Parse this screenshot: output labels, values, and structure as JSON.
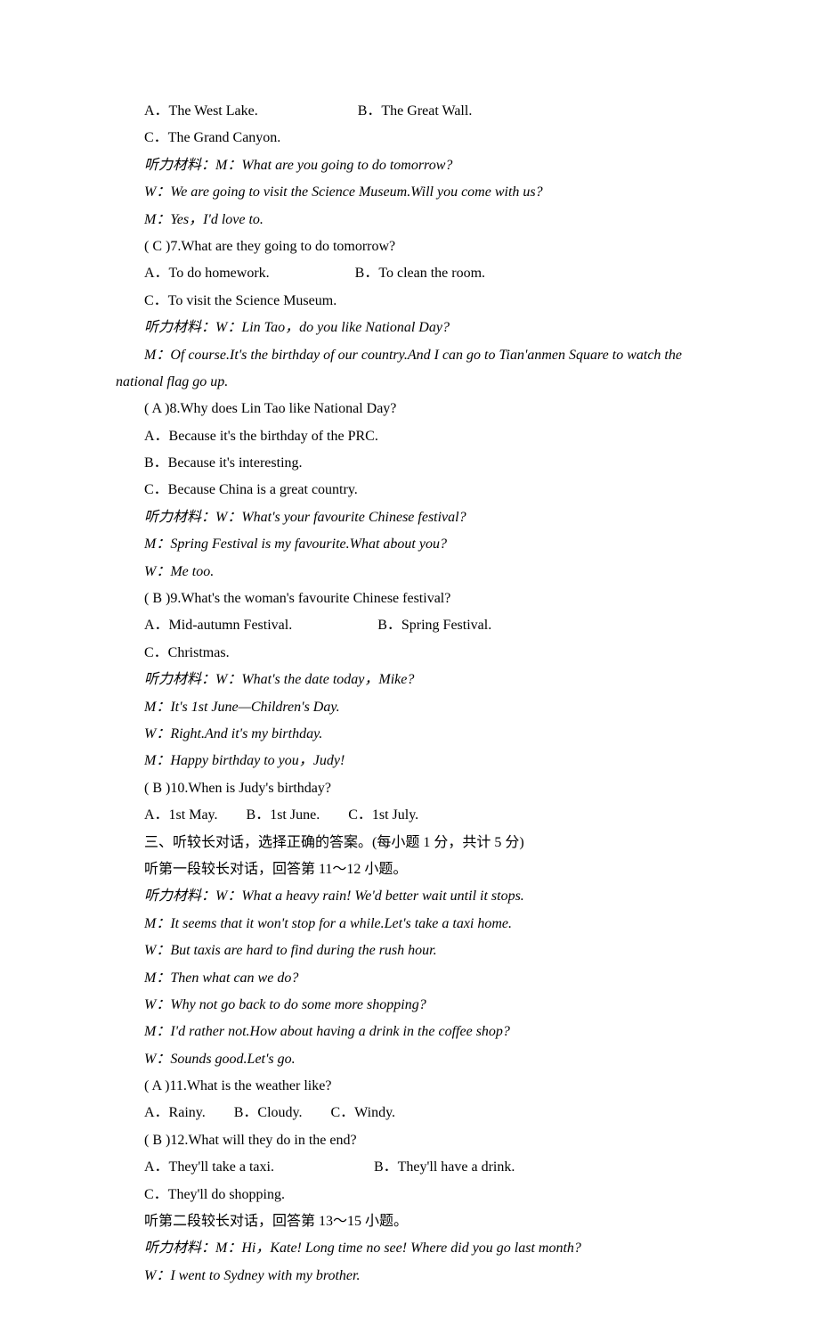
{
  "lines": [
    {
      "t": "A．The West Lake.　　　　　　　B．The Great Wall.",
      "i": false
    },
    {
      "t": "C．The Grand Canyon.",
      "i": false
    },
    {
      "t": "听力材料：M：What are you going to do tomorrow?",
      "i": true
    },
    {
      "t": "W：We are going to visit the Science Museum.Will you come with us?",
      "i": true
    },
    {
      "t": "M：Yes，I'd love to.",
      "i": true
    },
    {
      "t": "( C )7.What are they going to do tomorrow?",
      "i": false
    },
    {
      "t": "A．To do homework.　　　　　　B．To clean the room.",
      "i": false
    },
    {
      "t": "C．To visit the Science Museum.",
      "i": false
    },
    {
      "t": "听力材料：W：Lin Tao，do you like National Day?",
      "i": true
    },
    {
      "t": "M：Of course.It's the birthday of our country.And I can go to Tian'anmen Square to watch the national flag go up.",
      "i": true,
      "noindent": true,
      "hang": true
    },
    {
      "t": "( A )8.Why does Lin Tao like National Day?",
      "i": false
    },
    {
      "t": "A．Because it's the birthday of the PRC.",
      "i": false
    },
    {
      "t": "B．Because it's interesting.",
      "i": false
    },
    {
      "t": "C．Because China is a great country.",
      "i": false
    },
    {
      "t": "听力材料：W：What's your favourite Chinese festival?",
      "i": true
    },
    {
      "t": "M：Spring Festival is my favourite.What about you?",
      "i": true
    },
    {
      "t": "W：Me too.",
      "i": true
    },
    {
      "t": "( B )9.What's the woman's favourite Chinese festival?",
      "i": false
    },
    {
      "t": "A．Mid-autumn Festival.　　　　　　B．Spring Festival.",
      "i": false
    },
    {
      "t": "C．Christmas.",
      "i": false
    },
    {
      "t": "听力材料：W：What's the date today，Mike?",
      "i": true
    },
    {
      "t": "M：It's 1st June—Children's Day.",
      "i": true
    },
    {
      "t": "W：Right.And it's my birthday.",
      "i": true
    },
    {
      "t": "M：Happy birthday to you，Judy!",
      "i": true
    },
    {
      "t": "( B )10.When is Judy's birthday?",
      "i": false
    },
    {
      "t": "A．1st May.　　B．1st June.　　C．1st July.",
      "i": false
    },
    {
      "t": "三、听较长对话，选择正确的答案。(每小题 1 分，共计 5 分)",
      "i": false
    },
    {
      "t": "听第一段较长对话，回答第 11～12 小题。",
      "i": false
    },
    {
      "t": "听力材料：W：What a heavy rain! We'd better wait until it stops.",
      "i": true
    },
    {
      "t": "M：It seems that it won't stop for a while.Let's take a taxi home.",
      "i": true
    },
    {
      "t": "W：But taxis are hard to find during the rush hour.",
      "i": true
    },
    {
      "t": "M：Then what can we do?",
      "i": true
    },
    {
      "t": "W：Why not go back to do some more shopping?",
      "i": true
    },
    {
      "t": "M：I'd rather not.How about having a drink in the coffee shop?",
      "i": true
    },
    {
      "t": "W：Sounds good.Let's go.",
      "i": true
    },
    {
      "t": "( A )11.What is the weather like?",
      "i": false
    },
    {
      "t": "A．Rainy.　　B．Cloudy.　　C．Windy.",
      "i": false
    },
    {
      "t": "( B )12.What will they do in the end?",
      "i": false
    },
    {
      "t": "A．They'll take a taxi.　　　　　　　B．They'll have a drink.",
      "i": false
    },
    {
      "t": "C．They'll do shopping.",
      "i": false
    },
    {
      "t": "听第二段较长对话，回答第 13～15 小题。",
      "i": false
    },
    {
      "t": "听力材料：M：Hi，Kate! Long time no see! Where did you go last month?",
      "i": true
    },
    {
      "t": "W：I went to Sydney with my brother.",
      "i": true
    }
  ]
}
